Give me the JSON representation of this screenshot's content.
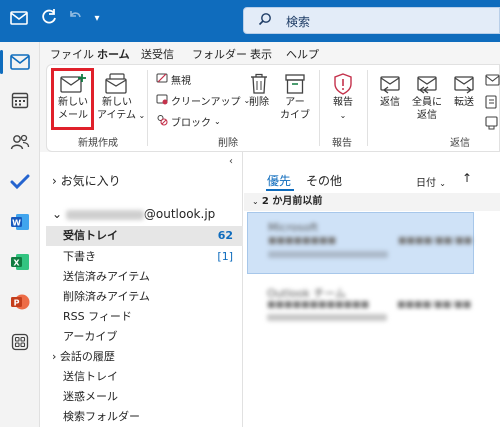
{
  "search": {
    "placeholder": "検索"
  },
  "menu_tabs": [
    "ファイル",
    "ホーム",
    "送受信",
    "フォルダー",
    "表示",
    "ヘルプ"
  ],
  "ribbon": {
    "new_mail_line1": "新しい",
    "new_mail_line2": "メール",
    "new_items_line1": "新しい",
    "new_items_line2": "アイテム",
    "ignore": "無視",
    "cleanup": "クリーンアップ",
    "block": "ブロック",
    "delete": "削除",
    "archive_line1": "アー",
    "archive_line2": "カイブ",
    "report": "報告",
    "reply": "返信",
    "reply_all_line1": "全員に",
    "reply_all_line2": "返信",
    "forward": "転送",
    "groups": {
      "new": "新規作成",
      "delete": "削除",
      "report": "報告",
      "respond": "返信"
    }
  },
  "folders": {
    "favorites": "お気に入り",
    "account_suffix": "@outlook.jp",
    "items": [
      {
        "label": "受信トレイ",
        "count": "62"
      },
      {
        "label": "下書き",
        "count": "[1]"
      },
      {
        "label": "送信済みアイテム",
        "count": ""
      },
      {
        "label": "削除済みアイテム",
        "count": ""
      },
      {
        "label": "RSS フィード",
        "count": ""
      },
      {
        "label": "アーカイブ",
        "count": ""
      },
      {
        "label": "会話の履歴",
        "count": ""
      },
      {
        "label": "送信トレイ",
        "count": ""
      },
      {
        "label": "迷惑メール",
        "count": ""
      },
      {
        "label": "検索フォルダー",
        "count": ""
      }
    ]
  },
  "messages": {
    "tab_focused": "優先",
    "tab_other": "その他",
    "sort_label": "日付",
    "group_header": "2 か月前以前",
    "items": [
      {
        "sender": "Microsoft",
        "subject": "■■■■■■■■",
        "date": "■■■■/■■/■■"
      },
      {
        "sender": "Outlook チーム",
        "subject": "■■■■■■■■■■■■",
        "date": "■■■■/■■/■■"
      }
    ]
  },
  "colors": {
    "accent": "#0f6cbd",
    "highlight_box": "#e0202a",
    "selected_message": "#cfe2f7"
  }
}
